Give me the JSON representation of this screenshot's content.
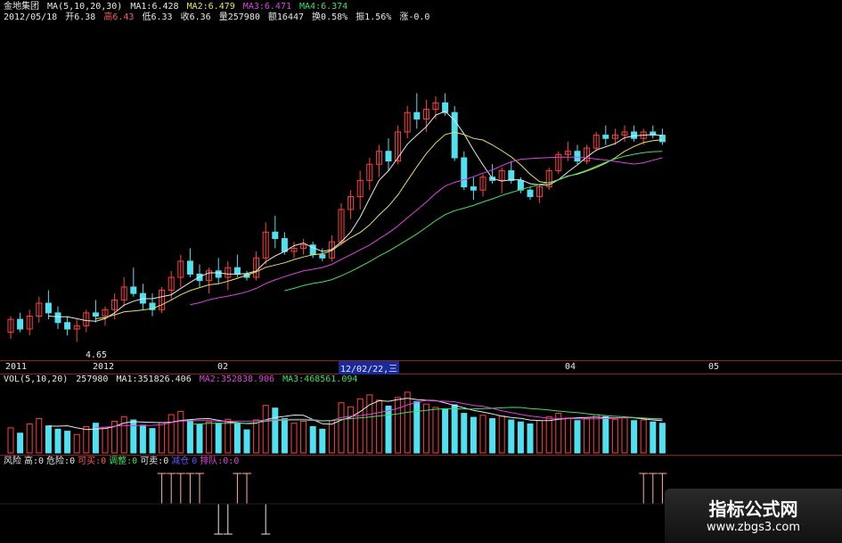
{
  "header": {
    "stock": "金地集团",
    "ma_label": "MA(5,10,20,30)",
    "ma1": "MA1:6.428",
    "ma2": "MA2:6.479",
    "ma3": "MA3:6.471",
    "ma4": "MA4:6.374",
    "date": "2012/05/18",
    "open": "开6.38",
    "high": "高6.43",
    "low": "低6.33",
    "close": "收6.36",
    "volume": "量257980",
    "amount": "额16447",
    "turnover": "换0.58%",
    "amplitude": "振1.56%",
    "change": "涨-0.0"
  },
  "price_chart": {
    "low_label": "4.65",
    "time_axis": [
      "2011",
      "2012",
      "02",
      "12/02/22,三",
      "04",
      "05"
    ]
  },
  "volume": {
    "label": "VOL(5,10,20)",
    "value": "257980",
    "ma1": "MA1:351826.406",
    "ma2": "MA2:352838.906",
    "ma3": "MA3:468561.094"
  },
  "indicator": {
    "items": [
      {
        "text": "风险",
        "color": "#e8e8e8"
      },
      {
        "text": "高:0",
        "color": "#e8e8e8"
      },
      {
        "text": "危险:0",
        "color": "#e8e8e8"
      },
      {
        "text": "可买:0",
        "color": "#ff5a5a"
      },
      {
        "text": "调整:0",
        "color": "#3ee060"
      },
      {
        "text": "可卖:0",
        "color": "#e8e8e8"
      },
      {
        "text": "减仓",
        "color": "#5a5aff"
      },
      {
        "text": "0",
        "color": "#5a5aff"
      },
      {
        "text": "排队:0:0",
        "color": "#e040e0"
      }
    ]
  },
  "watermark": {
    "title": "指标公式网",
    "url": "www.zbgs3.com"
  },
  "candles": [
    [
      7.2,
      7.7,
      7.0,
      7.6
    ],
    [
      7.6,
      7.8,
      7.2,
      7.3
    ],
    [
      7.3,
      7.9,
      7.1,
      7.7
    ],
    [
      7.7,
      8.3,
      7.5,
      8.1
    ],
    [
      8.1,
      8.5,
      7.6,
      7.8
    ],
    [
      7.8,
      8.0,
      7.3,
      7.5
    ],
    [
      7.5,
      7.7,
      7.1,
      7.3
    ],
    [
      7.3,
      7.6,
      6.9,
      7.4
    ],
    [
      7.4,
      7.9,
      7.2,
      7.8
    ],
    [
      7.8,
      8.2,
      7.5,
      7.7
    ],
    [
      7.7,
      8.0,
      7.4,
      7.9
    ],
    [
      7.9,
      8.4,
      7.6,
      8.2
    ],
    [
      8.2,
      8.9,
      8.0,
      8.6
    ],
    [
      8.6,
      9.2,
      8.3,
      8.4
    ],
    [
      8.4,
      8.7,
      7.9,
      8.1
    ],
    [
      8.1,
      8.4,
      7.7,
      7.9
    ],
    [
      7.9,
      8.6,
      7.8,
      8.5
    ],
    [
      8.5,
      9.1,
      8.2,
      8.9
    ],
    [
      8.9,
      9.6,
      8.6,
      9.4
    ],
    [
      9.4,
      9.8,
      8.9,
      9.0
    ],
    [
      9.0,
      9.3,
      8.6,
      8.8
    ],
    [
      8.8,
      9.2,
      8.4,
      9.1
    ],
    [
      9.1,
      9.5,
      8.7,
      8.9
    ],
    [
      8.9,
      9.4,
      8.5,
      9.2
    ],
    [
      9.2,
      9.6,
      8.9,
      9.0
    ],
    [
      9.0,
      9.1,
      8.8,
      8.9
    ],
    [
      8.9,
      9.7,
      8.8,
      9.5
    ],
    [
      9.5,
      10.6,
      9.3,
      10.3
    ],
    [
      10.3,
      10.8,
      9.8,
      10.1
    ],
    [
      10.1,
      10.3,
      9.6,
      9.7
    ],
    [
      9.7,
      10.0,
      9.5,
      9.8
    ],
    [
      9.8,
      10.1,
      9.6,
      9.9
    ],
    [
      9.9,
      10.0,
      9.5,
      9.6
    ],
    [
      9.6,
      9.8,
      9.4,
      9.5
    ],
    [
      9.5,
      10.2,
      9.4,
      10.0
    ],
    [
      10.0,
      11.2,
      9.9,
      11.0
    ],
    [
      11.0,
      11.6,
      10.7,
      11.4
    ],
    [
      11.4,
      12.2,
      11.0,
      11.9
    ],
    [
      11.9,
      12.6,
      11.6,
      12.4
    ],
    [
      12.4,
      13.0,
      12.0,
      12.8
    ],
    [
      12.8,
      13.2,
      12.2,
      12.5
    ],
    [
      12.5,
      13.6,
      12.4,
      13.4
    ],
    [
      13.4,
      14.2,
      13.2,
      14.0
    ],
    [
      14.0,
      14.6,
      13.5,
      13.8
    ],
    [
      13.8,
      14.4,
      13.4,
      14.1
    ],
    [
      14.1,
      14.5,
      13.8,
      14.3
    ],
    [
      14.3,
      14.6,
      13.9,
      14.0
    ],
    [
      14.0,
      14.2,
      12.5,
      12.6
    ],
    [
      12.6,
      12.8,
      11.6,
      11.7
    ],
    [
      11.7,
      12.0,
      11.3,
      11.6
    ],
    [
      11.6,
      12.1,
      11.4,
      12.0
    ],
    [
      12.0,
      12.4,
      11.8,
      11.9
    ],
    [
      11.9,
      12.3,
      11.5,
      12.2
    ],
    [
      12.2,
      12.5,
      11.8,
      11.9
    ],
    [
      11.9,
      12.0,
      11.5,
      11.6
    ],
    [
      11.6,
      11.7,
      11.3,
      11.4
    ],
    [
      11.4,
      11.8,
      11.2,
      11.7
    ],
    [
      11.7,
      12.3,
      11.6,
      12.2
    ],
    [
      12.2,
      12.8,
      12.1,
      12.7
    ],
    [
      12.7,
      13.1,
      12.5,
      12.8
    ],
    [
      12.8,
      13.0,
      12.4,
      12.5
    ],
    [
      12.5,
      13.0,
      12.4,
      12.9
    ],
    [
      12.9,
      13.4,
      12.8,
      13.3
    ],
    [
      13.3,
      13.6,
      13.0,
      13.2
    ],
    [
      13.2,
      13.5,
      13.0,
      13.3
    ],
    [
      13.3,
      13.6,
      13.1,
      13.4
    ],
    [
      13.4,
      13.6,
      13.1,
      13.2
    ],
    [
      13.2,
      13.5,
      13.0,
      13.4
    ],
    [
      13.4,
      13.6,
      13.2,
      13.3
    ],
    [
      13.3,
      13.5,
      13.0,
      13.1
    ]
  ],
  "volumes": [
    38,
    30,
    44,
    52,
    41,
    36,
    33,
    28,
    40,
    45,
    39,
    48,
    55,
    50,
    42,
    37,
    46,
    58,
    63,
    49,
    43,
    47,
    45,
    51,
    44,
    35,
    50,
    72,
    68,
    52,
    45,
    48,
    40,
    36,
    49,
    76,
    70,
    82,
    88,
    80,
    71,
    84,
    92,
    78,
    74,
    69,
    66,
    73,
    60,
    54,
    57,
    52,
    56,
    50,
    47,
    44,
    49,
    55,
    60,
    53,
    49,
    52,
    58,
    55,
    51,
    53,
    49,
    50,
    47,
    45
  ],
  "risk": [
    0,
    0,
    0,
    0,
    0,
    0,
    0,
    0,
    0,
    0,
    0,
    0,
    0,
    0,
    0,
    0,
    1,
    1,
    1,
    1,
    1,
    0,
    -1,
    -1,
    1,
    1,
    0,
    -1,
    0,
    0,
    0,
    0,
    0,
    0,
    0,
    0,
    0,
    0,
    0,
    0,
    0,
    0,
    0,
    0,
    0,
    0,
    0,
    0,
    0,
    0,
    0,
    0,
    0,
    0,
    0,
    0,
    0,
    0,
    0,
    0,
    0,
    0,
    0,
    0,
    0,
    0,
    0,
    1,
    1,
    1
  ]
}
